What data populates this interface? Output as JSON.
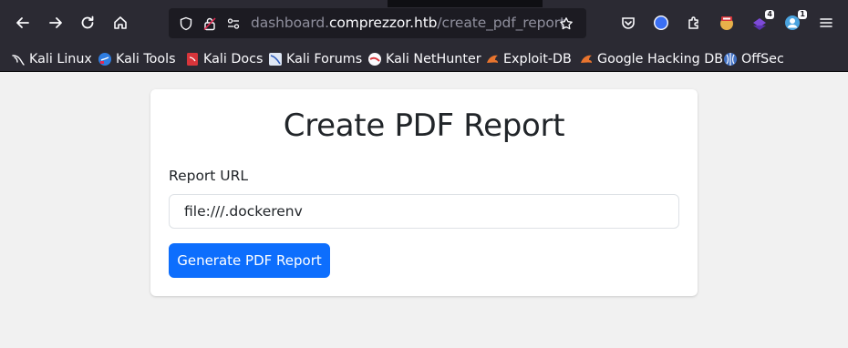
{
  "browser": {
    "url_scheme_hidden": "",
    "url_prefix": "dashboard.",
    "url_host": "comprezzor.htb",
    "url_path": "/create_pdf_report",
    "extension_badges": [
      "4",
      "1"
    ]
  },
  "bookmarks": [
    {
      "label": "Kali Linux",
      "icon": "kali-dragon-icon"
    },
    {
      "label": "Kali Tools",
      "icon": "kali-tools-icon"
    },
    {
      "label": "Kali Docs",
      "icon": "kali-docs-icon"
    },
    {
      "label": "Kali Forums",
      "icon": "kali-forums-icon"
    },
    {
      "label": "Kali NetHunter",
      "icon": "nethunter-icon"
    },
    {
      "label": "Exploit-DB",
      "icon": "exploit-db-icon"
    },
    {
      "label": "Google Hacking DB",
      "icon": "ghdb-icon"
    },
    {
      "label": "OffSec",
      "icon": "offsec-icon"
    }
  ],
  "form": {
    "title": "Create PDF Report",
    "url_label": "Report URL",
    "url_value": "file:///.dockerenv",
    "submit_label": "Generate PDF Report"
  },
  "colors": {
    "primary": "#0d6efd",
    "page_bg": "#f1f1f1",
    "toolbar_bg": "#2b2a33"
  }
}
